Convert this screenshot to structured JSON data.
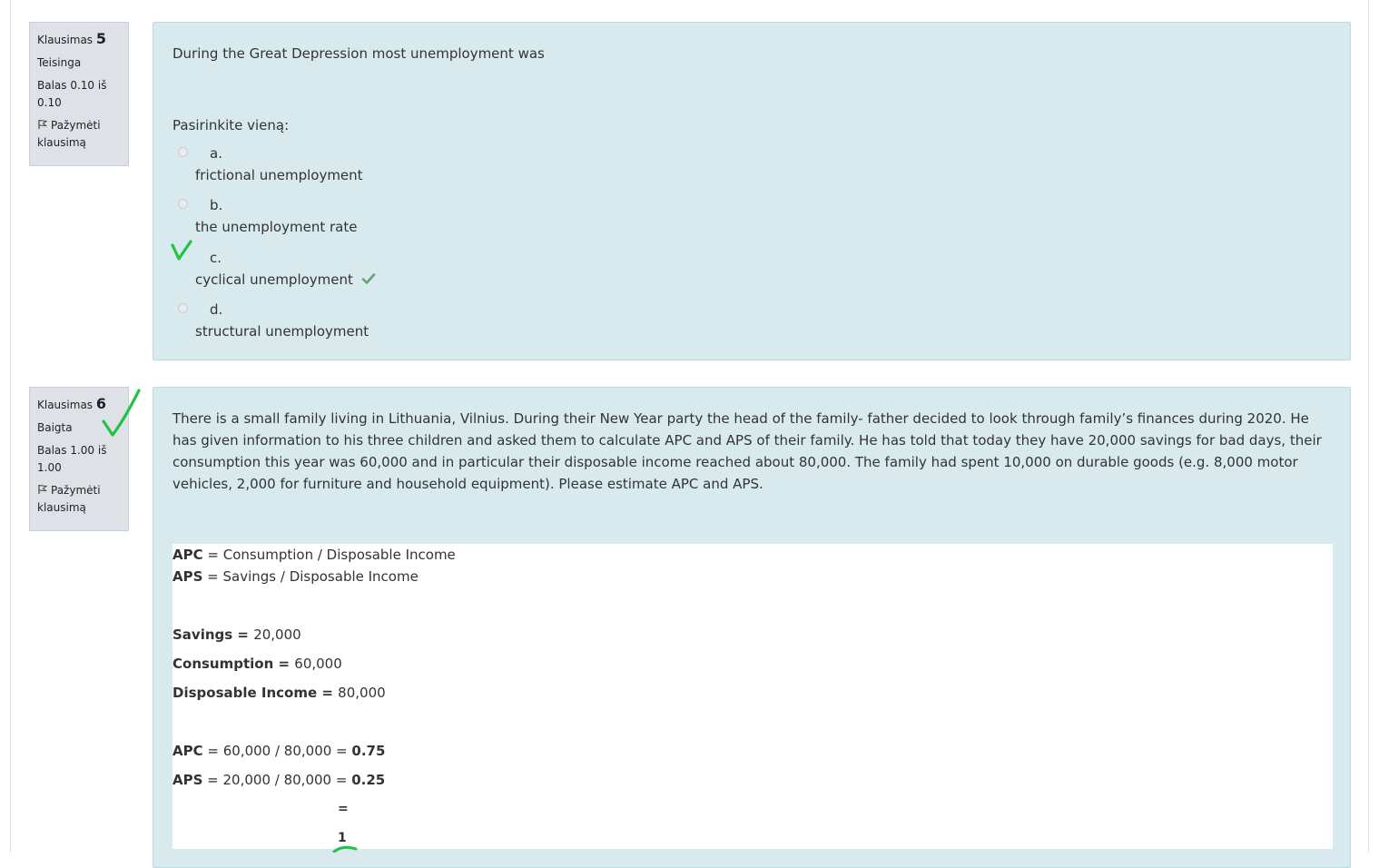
{
  "questions": [
    {
      "number_label": "Klausimas",
      "number": "5",
      "state": "Teisinga",
      "grade": "Balas 0.10 iš 0.10",
      "flag_label": "Pažymėti klausimą",
      "text": "During the Great Depression most unemployment was",
      "prompt": "Pasirinkite vieną:",
      "options": [
        {
          "letter": "a.",
          "text": "frictional unemployment"
        },
        {
          "letter": "b.",
          "text": "the unemployment rate"
        },
        {
          "letter": "c.",
          "text": "cyclical unemployment"
        },
        {
          "letter": "d.",
          "text": "structural unemployment"
        }
      ]
    },
    {
      "number_label": "Klausimas",
      "number": "6",
      "state": "Baigta",
      "grade": "Balas 1.00 iš 1.00",
      "flag_label": "Pažymėti klausimą",
      "text": "There is a small family living in Lithuania, Vilnius. During their New Year party the head of the family- father decided to look through family’s finances during 2020. He has given information to his three children and asked them to calculate APC and APS of their family. He has told that today they have 20,000 savings for bad days, their consumption this year was 60,000 and in particular their disposable income reached about 80,000. The family had spent 10,000 on durable goods (e.g. 8,000 motor vehicles, 2,000 for furniture and household equipment). Please estimate APC and APS.",
      "answer": {
        "apc_label": "APC",
        "apc_formula": " = Consumption / Disposable Income",
        "aps_label": "APS",
        "aps_formula": " = Savings / Disposable Income",
        "savings_label": "Savings = ",
        "savings_value": "20,000",
        "consumption_label": "Consumption = ",
        "consumption_value": "60,000",
        "income_label": "Disposable Income = ",
        "income_value": " 80,000",
        "apc_calc": " = 60,000 / 80,000 = ",
        "apc_result": "0.75",
        "aps_calc": " = 20,000 / 80,000 = ",
        "aps_result": "0.25",
        "sum_eq": "=",
        "sum_result": "1"
      }
    }
  ],
  "colors": {
    "content_bg": "#d9eaef",
    "info_bg": "#dee2e6",
    "correct_green": "#5ca96b",
    "hand_green": "#22c245"
  }
}
